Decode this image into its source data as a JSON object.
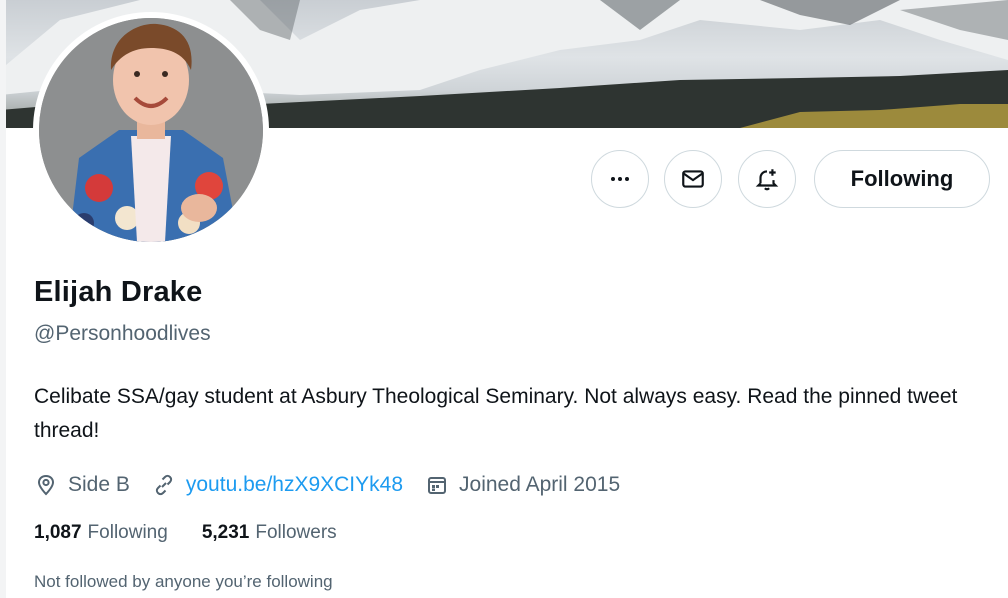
{
  "profile": {
    "name": "Elijah Drake",
    "handle": "@Personhoodlives",
    "bio": "Celibate SSA/gay student at Asbury Theological Seminary. Not always easy. Read the pinned tweet thread!",
    "location": "Side B",
    "website": "youtu.be/hzX9XCIYk48",
    "joined": "Joined April 2015"
  },
  "stats": {
    "following_count": "1,087",
    "following_label": "Following",
    "followers_count": "5,231",
    "followers_label": "Followers"
  },
  "actions": {
    "follow_state_label": "Following",
    "more_icon": "more-icon",
    "message_icon": "message-icon",
    "notify_icon": "bell-add-icon"
  },
  "social_context": "Not followed by anyone you’re following",
  "colors": {
    "link": "#1d9bf0",
    "muted": "#536471",
    "text": "#0f1419",
    "border": "#cfd9de"
  }
}
